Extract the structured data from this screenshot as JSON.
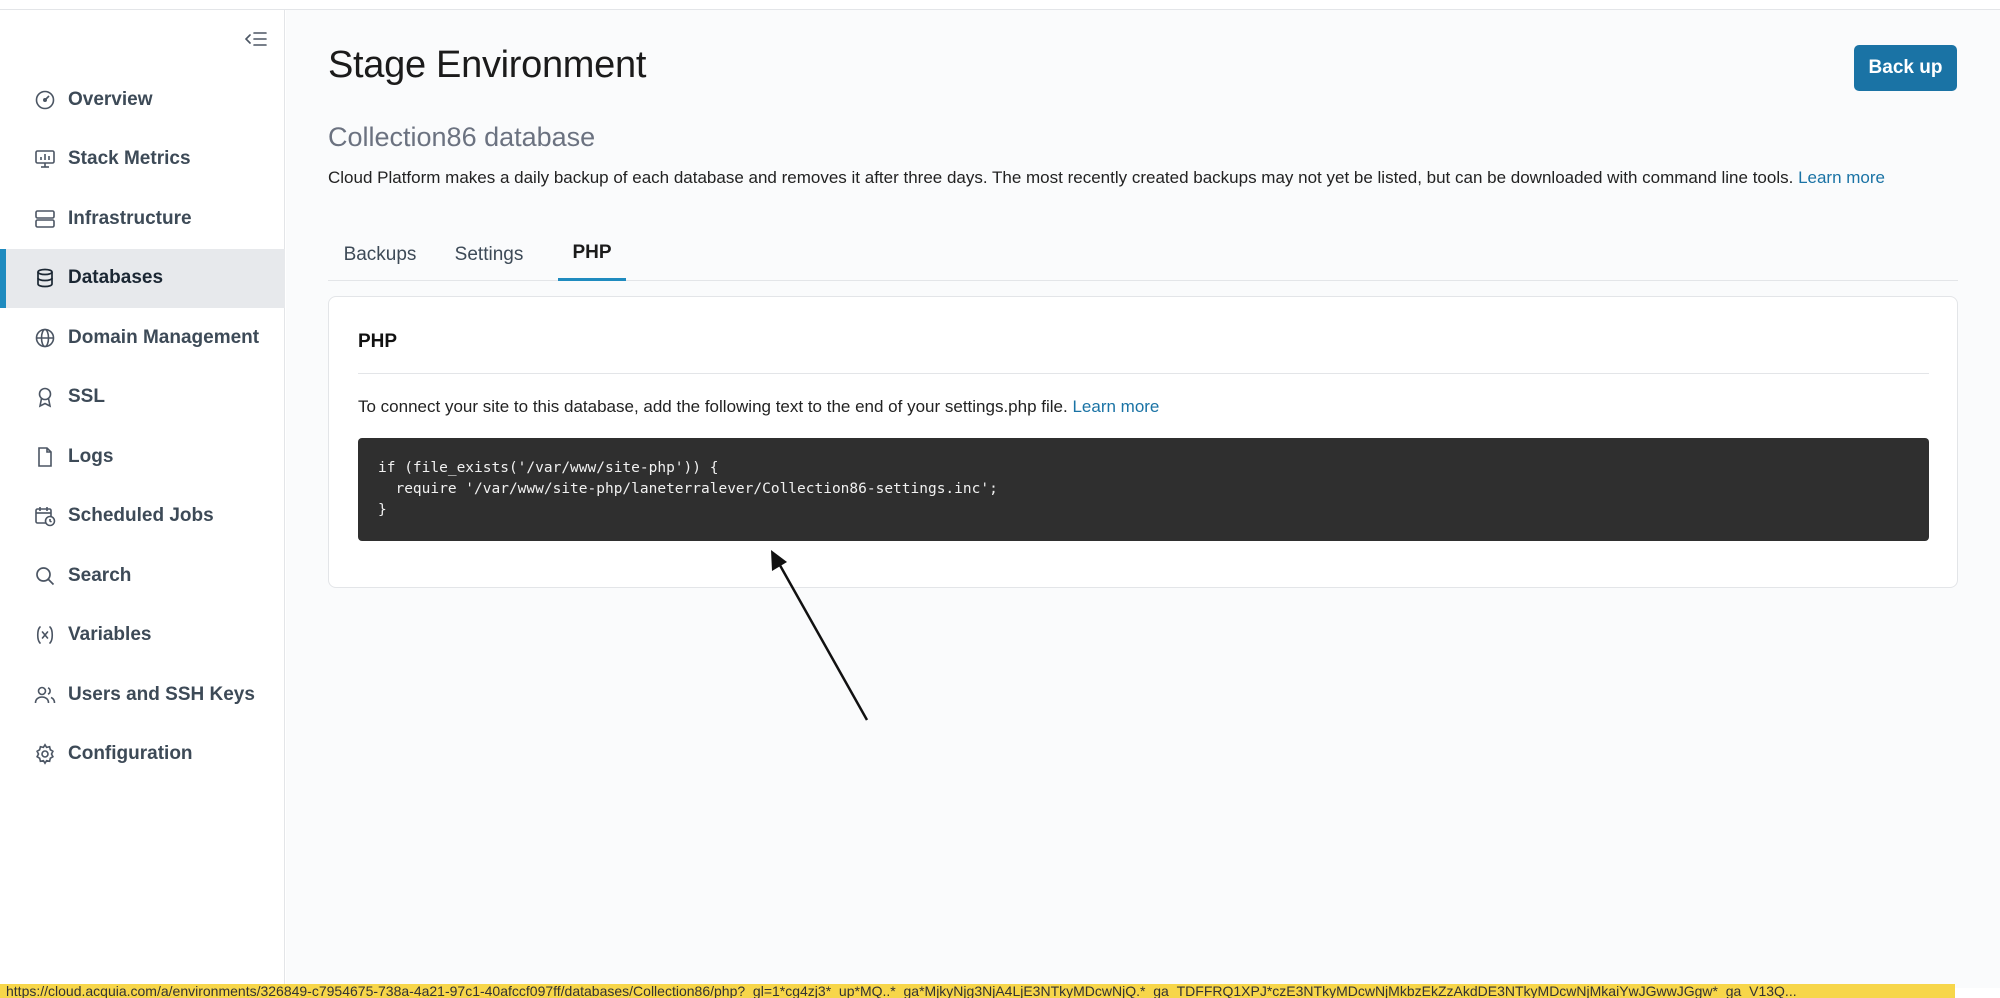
{
  "sidebar": {
    "collapse_icon": "collapse-sidebar-icon",
    "items": [
      {
        "label": "Overview",
        "icon": "dashboard-icon"
      },
      {
        "label": "Stack Metrics",
        "icon": "monitor-icon"
      },
      {
        "label": "Infrastructure",
        "icon": "server-icon"
      },
      {
        "label": "Databases",
        "icon": "database-icon",
        "active": true
      },
      {
        "label": "Domain Management",
        "icon": "globe-icon"
      },
      {
        "label": "SSL",
        "icon": "ribbon-icon"
      },
      {
        "label": "Logs",
        "icon": "file-icon"
      },
      {
        "label": "Scheduled Jobs",
        "icon": "calendar-clock-icon"
      },
      {
        "label": "Search",
        "icon": "search-icon"
      },
      {
        "label": "Variables",
        "icon": "variable-icon"
      },
      {
        "label": "Users and SSH Keys",
        "icon": "users-icon"
      },
      {
        "label": "Configuration",
        "icon": "gear-icon"
      }
    ]
  },
  "header": {
    "title": "Stage Environment",
    "backup_label": "Back up",
    "subtitle": "Collection86 database",
    "description": "Cloud Platform makes a daily backup of each database and removes it after three days. The most recently created backups may not yet be listed, but can be downloaded with command line tools.",
    "learn_more": "Learn more"
  },
  "tabs": [
    {
      "label": "Backups"
    },
    {
      "label": "Settings"
    },
    {
      "label": "PHP",
      "active": true
    }
  ],
  "php_card": {
    "title": "PHP",
    "text": "To connect your site to this database, add the following text to the end of your settings.php file.",
    "learn_more": "Learn more",
    "code": [
      "if (file_exists('/var/www/site-php')) {",
      "  require '/var/www/site-php/laneterralever/Collection86-settings.inc';",
      "}"
    ]
  },
  "statusbar": {
    "url": "https://cloud.acquia.com/a/environments/326849-c7954675-738a-4a21-97c1-40afccf097ff/databases/Collection86/php?_gl=1*cg4zj3*_up*MQ..*_ga*MjkyNjg3NjA4LjE3NTkyMDcwNjQ.*_ga_TDFFRQ1XPJ*czE3NTkyMDcwNjMkbzEkZzAkdDE3NTkyMDcwNjMkaiYwJGwwJGgw*_ga_V13Q..."
  },
  "colors": {
    "accent": "#1f8bbf",
    "button": "#1a73a5",
    "code_bg": "#2f2f2f",
    "statusbar": "#f7d64a"
  }
}
